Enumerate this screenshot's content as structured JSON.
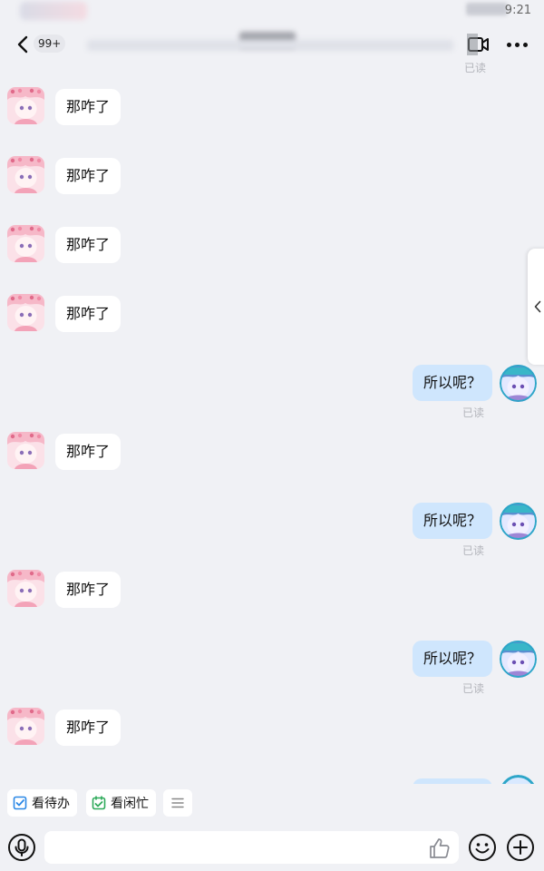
{
  "status_bar": {
    "time": "9:21"
  },
  "header": {
    "unread_count": "99+",
    "back_icon": "chevron-left-icon",
    "video_icon": "video-call-icon",
    "more_icon": "more-dots-icon"
  },
  "top_read_label": "已读",
  "messages": [
    {
      "side": "left",
      "text": "那咋了"
    },
    {
      "side": "left",
      "text": "那咋了"
    },
    {
      "side": "left",
      "text": "那咋了"
    },
    {
      "side": "left",
      "text": "那咋了"
    },
    {
      "side": "right",
      "text": "所以呢？",
      "status": "已读"
    },
    {
      "side": "left",
      "text": "那咋了"
    },
    {
      "side": "right",
      "text": "所以呢？",
      "status": "已读"
    },
    {
      "side": "left",
      "text": "那咋了"
    },
    {
      "side": "right",
      "text": "所以呢？",
      "status": "已读"
    },
    {
      "side": "left",
      "text": "那咋了"
    }
  ],
  "quick_actions": {
    "todo_label": "看待办",
    "busy_label": "看闲忙"
  },
  "composer": {
    "placeholder": ""
  },
  "colors": {
    "background": "#f0f1f5",
    "bubble_self": "#cfe6fd",
    "bubble_other": "#ffffff",
    "read_label": "#b3b5bb",
    "todo_icon": "#2b88e6",
    "busy_icon": "#2eaa5a"
  }
}
